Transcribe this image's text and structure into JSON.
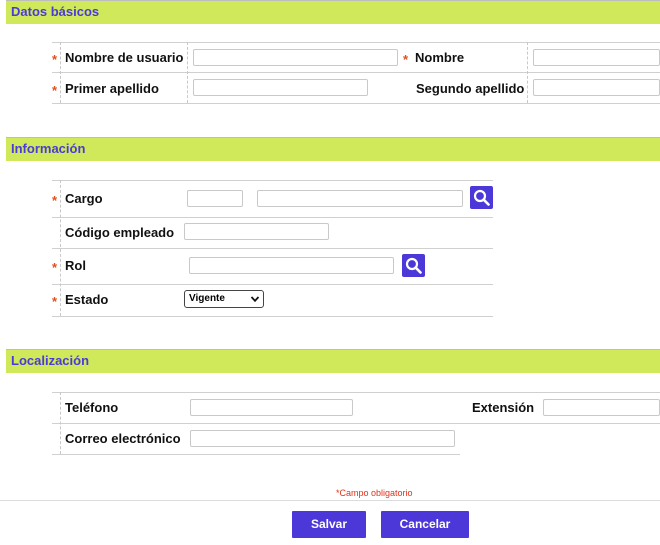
{
  "sections": {
    "basic": {
      "title": "Datos básicos"
    },
    "info": {
      "title": "Información"
    },
    "location": {
      "title": "Localización"
    }
  },
  "required_mark": "*",
  "fields": {
    "username": {
      "label": "Nombre de usuario",
      "value": ""
    },
    "first_name": {
      "label": "Nombre",
      "value": ""
    },
    "first_surname": {
      "label": "Primer apellido",
      "value": ""
    },
    "second_surname": {
      "label": "Segundo apellido",
      "value": ""
    },
    "position": {
      "label": "Cargo",
      "code": "",
      "description": ""
    },
    "employee_code": {
      "label": "Código empleado",
      "value": ""
    },
    "role": {
      "label": "Rol",
      "value": ""
    },
    "status": {
      "label": "Estado",
      "selected": "Vigente"
    },
    "phone": {
      "label": "Teléfono",
      "value": ""
    },
    "extension": {
      "label": "Extensión",
      "value": ""
    },
    "email": {
      "label": "Correo electrónico",
      "value": ""
    }
  },
  "footer": {
    "required_note": "*Campo obligatorio",
    "save_label": "Salvar",
    "cancel_label": "Cancelar"
  },
  "colors": {
    "accent": "#4c38d8",
    "section_bar": "#cfe95a",
    "required": "#e0501a"
  },
  "icons": {
    "lookup": "search-icon",
    "dropdown": "chevron-down-icon"
  }
}
